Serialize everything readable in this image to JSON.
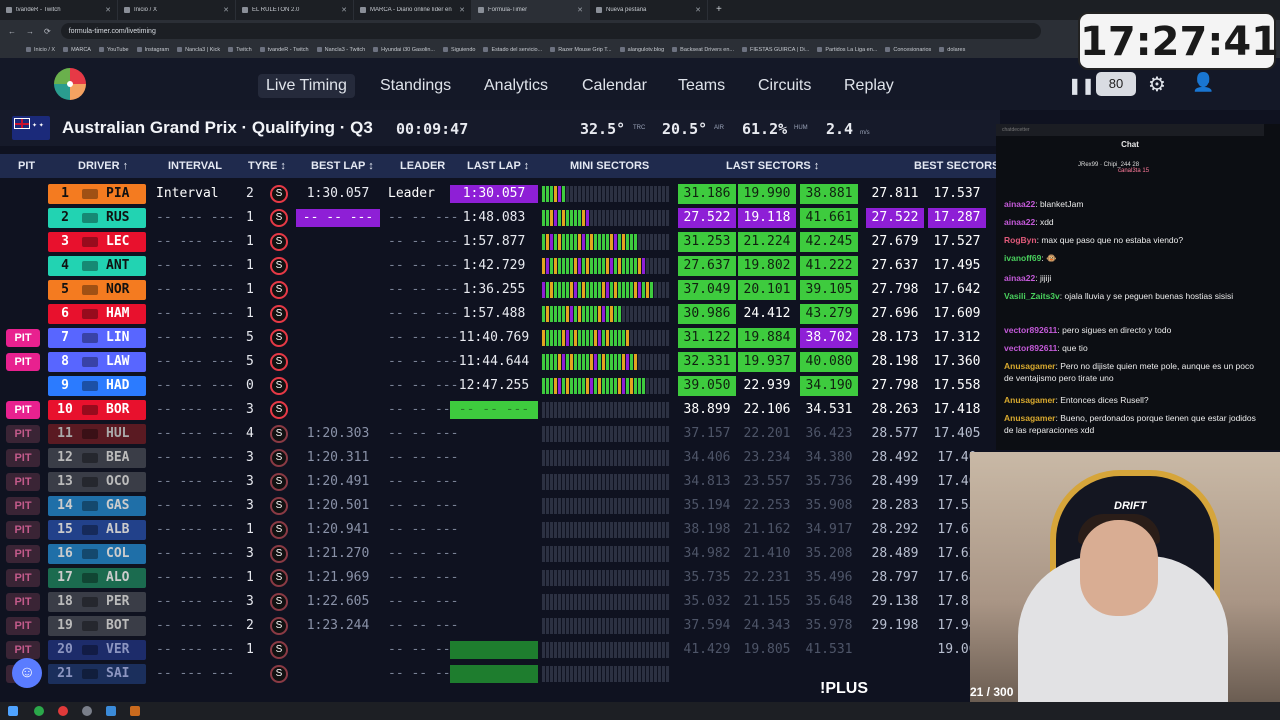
{
  "browser": {
    "tabs": [
      {
        "title": "tvandeR - Twitch",
        "active": false
      },
      {
        "title": "Inicio / X",
        "active": false
      },
      {
        "title": "EL RULETON 2.0",
        "active": false
      },
      {
        "title": "MARCA - Diario online líder en",
        "active": false
      },
      {
        "title": "Formula-Timer",
        "active": true
      },
      {
        "title": "Nueva pestaña",
        "active": false
      }
    ],
    "new_tab": "+",
    "url": "formula-timer.com/livetiming",
    "bookmarks": [
      "Inicio / X",
      "MARCA",
      "YouTube",
      "Instagram",
      "Nancla3 | Kick",
      "Twitch",
      "tvandeR - Twitch",
      "Nancla3 - Twitch",
      "Hyundai i30 Gasolin...",
      "Siguiendo",
      "Estado del servicio...",
      "Razer Mouse Grip T...",
      "alangulotv.blog",
      "Backseat Drivers en...",
      "FIESTAS GUIRCA | Di...",
      "Partidos La Liga en...",
      "Concesionarios",
      "dolares"
    ]
  },
  "nav": {
    "links": [
      "Live Timing",
      "Standings",
      "Analytics",
      "Calendar",
      "Teams",
      "Circuits",
      "Replay"
    ],
    "active": "Live Timing",
    "pause_icon": "❚❚",
    "delay_value": "80",
    "settings_icon": "⚙",
    "user_icon": "👤"
  },
  "session": {
    "title": "Australian Grand Prix · Qualifying · Q3",
    "clock": "00:09:47",
    "track_temp": "32.5°",
    "track_label": "TRC",
    "air_temp": "20.5°",
    "air_label": "AIR",
    "humidity": "61.2%",
    "humidity_label": "HUM",
    "wind": "2.4",
    "wind_unit": "m/s"
  },
  "table": {
    "headers": [
      "PIT",
      "DRIVER ↑",
      "INTERVAL",
      "TYRE ↕",
      "BEST LAP ↕",
      "LEADER",
      "LAST LAP ↕",
      "MINI SECTORS",
      "LAST SECTORS ↕",
      "BEST SECTORS"
    ],
    "rows": [
      {
        "pit": "",
        "pos": "1",
        "code": "PIA",
        "color": "#f47b20",
        "text": "#111",
        "interval": "Interval",
        "tyre_laps": "2",
        "best": "1:30.057",
        "best_bg": "",
        "leader": "Leader",
        "last": "1:30.057",
        "last_bg": "#8e1fd6",
        "ls": [
          "31.186",
          "19.990",
          "38.881"
        ],
        "ls_bg": [
          "#3ecb3e",
          "#3ecb3e",
          "#3ecb3e"
        ],
        "bs": [
          "27.811",
          "17.537",
          "3"
        ],
        "bs_bg": [
          "",
          "",
          ""
        ],
        "dim": false
      },
      {
        "pit": "",
        "pos": "2",
        "code": "RUS",
        "color": "#22d3b2",
        "text": "#111",
        "interval": "-- --- ---",
        "tyre_laps": "1",
        "best": "-- -- ---",
        "best_bg": "#8e1fd6",
        "leader": "-- -- ---",
        "last": "1:48.083",
        "last_bg": "",
        "ls": [
          "27.522",
          "19.118",
          "41.661"
        ],
        "ls_bg": [
          "#8e1fd6",
          "#8e1fd6",
          "#3ecb3e"
        ],
        "bs": [
          "27.522",
          "17.287",
          "3"
        ],
        "bs_bg": [
          "#8e1fd6",
          "#8e1fd6",
          ""
        ],
        "dim": false
      },
      {
        "pit": "",
        "pos": "3",
        "code": "LEC",
        "color": "#e8112d",
        "text": "#fff",
        "interval": "-- --- ---",
        "tyre_laps": "1",
        "best": "",
        "best_bg": "",
        "leader": "-- -- ---",
        "last": "1:57.877",
        "last_bg": "",
        "ls": [
          "31.253",
          "21.224",
          "42.245"
        ],
        "ls_bg": [
          "#3ecb3e",
          "#3ecb3e",
          "#3ecb3e"
        ],
        "bs": [
          "27.679",
          "17.527",
          "3"
        ],
        "bs_bg": [
          "",
          "",
          ""
        ],
        "dim": false
      },
      {
        "pit": "",
        "pos": "4",
        "code": "ANT",
        "color": "#22d3b2",
        "text": "#111",
        "interval": "-- --- ---",
        "tyre_laps": "1",
        "best": "",
        "best_bg": "",
        "leader": "-- -- ---",
        "last": "1:42.729",
        "last_bg": "",
        "ls": [
          "27.637",
          "19.802",
          "41.222"
        ],
        "ls_bg": [
          "#3ecb3e",
          "#3ecb3e",
          "#3ecb3e"
        ],
        "bs": [
          "27.637",
          "17.495",
          "3"
        ],
        "bs_bg": [
          "",
          "",
          ""
        ],
        "dim": false
      },
      {
        "pit": "",
        "pos": "5",
        "code": "NOR",
        "color": "#f47b20",
        "text": "#111",
        "interval": "-- --- ---",
        "tyre_laps": "1",
        "best": "",
        "best_bg": "",
        "leader": "-- -- ---",
        "last": "1:36.255",
        "last_bg": "",
        "ls": [
          "37.049",
          "20.101",
          "39.105"
        ],
        "ls_bg": [
          "#3ecb3e",
          "#3ecb3e",
          "#3ecb3e"
        ],
        "bs": [
          "27.798",
          "17.642",
          "3"
        ],
        "bs_bg": [
          "",
          "",
          ""
        ],
        "dim": false
      },
      {
        "pit": "",
        "pos": "6",
        "code": "HAM",
        "color": "#e8112d",
        "text": "#fff",
        "interval": "-- --- ---",
        "tyre_laps": "1",
        "best": "",
        "best_bg": "",
        "leader": "-- -- ---",
        "last": "1:57.488",
        "last_bg": "",
        "ls": [
          "30.986",
          "24.412",
          "43.279"
        ],
        "ls_bg": [
          "#3ecb3e",
          "",
          "#3ecb3e"
        ],
        "bs": [
          "27.696",
          "17.609",
          "3"
        ],
        "bs_bg": [
          "",
          "",
          ""
        ],
        "dim": false
      },
      {
        "pit": "PIT",
        "pos": "7",
        "code": "LIN",
        "color": "#5866ff",
        "text": "#fff",
        "interval": "-- --- ---",
        "tyre_laps": "5",
        "best": "",
        "best_bg": "",
        "leader": "-- -- ---",
        "last": "11:40.769",
        "last_bg": "",
        "ls": [
          "31.122",
          "19.884",
          "38.702"
        ],
        "ls_bg": [
          "#3ecb3e",
          "#3ecb3e",
          "#8e1fd6"
        ],
        "bs": [
          "28.173",
          "17.312",
          "3"
        ],
        "bs_bg": [
          "",
          "",
          ""
        ],
        "dim": false
      },
      {
        "pit": "PIT",
        "pos": "8",
        "code": "LAW",
        "color": "#5866ff",
        "text": "#fff",
        "interval": "-- --- ---",
        "tyre_laps": "5",
        "best": "",
        "best_bg": "",
        "leader": "-- -- ---",
        "last": "11:44.644",
        "last_bg": "",
        "ls": [
          "32.331",
          "19.937",
          "40.080"
        ],
        "ls_bg": [
          "#3ecb3e",
          "#3ecb3e",
          "#3ecb3e"
        ],
        "bs": [
          "28.198",
          "17.360",
          "3"
        ],
        "bs_bg": [
          "",
          "",
          ""
        ],
        "dim": false
      },
      {
        "pit": "",
        "pos": "9",
        "code": "HAD",
        "color": "#2b7bff",
        "text": "#fff",
        "interval": "-- --- ---",
        "tyre_laps": "0",
        "best": "",
        "best_bg": "",
        "leader": "-- -- ---",
        "last": "12:47.255",
        "last_bg": "",
        "ls": [
          "39.050",
          "22.939",
          "34.190"
        ],
        "ls_bg": [
          "#3ecb3e",
          "",
          "#3ecb3e"
        ],
        "bs": [
          "27.798",
          "17.558",
          "3"
        ],
        "bs_bg": [
          "",
          "",
          ""
        ],
        "dim": false
      },
      {
        "pit": "PIT",
        "pos": "10",
        "code": "BOR",
        "color": "#e8112d",
        "text": "#fff",
        "interval": "-- --- ---",
        "tyre_laps": "3",
        "best": "",
        "best_bg": "",
        "leader": "-- -- ---",
        "last": "-- -- ---",
        "last_bg": "#3ecb3e",
        "ls": [
          "38.899",
          "22.106",
          "34.531"
        ],
        "ls_bg": [
          "",
          "",
          ""
        ],
        "bs": [
          "28.263",
          "17.418",
          "3"
        ],
        "bs_bg": [
          "",
          "",
          ""
        ],
        "dim": false
      },
      {
        "pit": "PIT",
        "pos": "11",
        "code": "HUL",
        "color": "#5a1a22",
        "text": "#aaa",
        "interval": "-- --- ---",
        "tyre_laps": "4",
        "best": "1:20.303",
        "best_bg": "",
        "leader": "-- -- ---",
        "last": "",
        "last_bg": "",
        "ls": [
          "37.157",
          "22.201",
          "36.423"
        ],
        "ls_bg": [
          "",
          "",
          ""
        ],
        "bs": [
          "28.577",
          "17.405",
          "3"
        ],
        "bs_bg": [
          "",
          "",
          ""
        ],
        "dim": true
      },
      {
        "pit": "PIT",
        "pos": "12",
        "code": "BEA",
        "color": "#3a3d47",
        "text": "#bbb",
        "interval": "-- --- ---",
        "tyre_laps": "3",
        "best": "1:20.311",
        "best_bg": "",
        "leader": "-- -- ---",
        "last": "",
        "last_bg": "",
        "ls": [
          "34.406",
          "23.234",
          "34.380"
        ],
        "ls_bg": [
          "",
          "",
          ""
        ],
        "bs": [
          "28.492",
          "17.40",
          ""
        ],
        "bs_bg": [
          "",
          "",
          ""
        ],
        "dim": true
      },
      {
        "pit": "PIT",
        "pos": "13",
        "code": "OCO",
        "color": "#3a3d47",
        "text": "#bbb",
        "interval": "-- --- ---",
        "tyre_laps": "3",
        "best": "1:20.491",
        "best_bg": "",
        "leader": "-- -- ---",
        "last": "",
        "last_bg": "",
        "ls": [
          "34.813",
          "23.557",
          "35.736"
        ],
        "ls_bg": [
          "",
          "",
          ""
        ],
        "bs": [
          "28.499",
          "17.46",
          ""
        ],
        "bs_bg": [
          "",
          "",
          ""
        ],
        "dim": true
      },
      {
        "pit": "PIT",
        "pos": "14",
        "code": "GAS",
        "color": "#1f6fa8",
        "text": "#ccc",
        "interval": "-- --- ---",
        "tyre_laps": "3",
        "best": "1:20.501",
        "best_bg": "",
        "leader": "-- -- ---",
        "last": "",
        "last_bg": "",
        "ls": [
          "35.194",
          "22.253",
          "35.908"
        ],
        "ls_bg": [
          "",
          "",
          ""
        ],
        "bs": [
          "28.283",
          "17.55",
          ""
        ],
        "bs_bg": [
          "",
          "",
          ""
        ],
        "dim": true
      },
      {
        "pit": "PIT",
        "pos": "15",
        "code": "ALB",
        "color": "#22418a",
        "text": "#ccc",
        "interval": "-- --- ---",
        "tyre_laps": "1",
        "best": "1:20.941",
        "best_bg": "",
        "leader": "-- -- ---",
        "last": "",
        "last_bg": "",
        "ls": [
          "38.198",
          "21.162",
          "34.917"
        ],
        "ls_bg": [
          "",
          "",
          ""
        ],
        "bs": [
          "28.292",
          "17.67",
          ""
        ],
        "bs_bg": [
          "",
          "",
          ""
        ],
        "dim": true
      },
      {
        "pit": "PIT",
        "pos": "16",
        "code": "COL",
        "color": "#1f6fa8",
        "text": "#ccc",
        "interval": "-- --- ---",
        "tyre_laps": "3",
        "best": "1:21.270",
        "best_bg": "",
        "leader": "-- -- ---",
        "last": "",
        "last_bg": "",
        "ls": [
          "34.982",
          "21.410",
          "35.208"
        ],
        "ls_bg": [
          "",
          "",
          ""
        ],
        "bs": [
          "28.489",
          "17.62",
          ""
        ],
        "bs_bg": [
          "",
          "",
          ""
        ],
        "dim": true
      },
      {
        "pit": "PIT",
        "pos": "17",
        "code": "ALO",
        "color": "#1b6b4f",
        "text": "#ccc",
        "interval": "-- --- ---",
        "tyre_laps": "1",
        "best": "1:21.969",
        "best_bg": "",
        "leader": "-- -- ---",
        "last": "",
        "last_bg": "",
        "ls": [
          "35.735",
          "22.231",
          "35.496"
        ],
        "ls_bg": [
          "",
          "",
          ""
        ],
        "bs": [
          "28.797",
          "17.68",
          ""
        ],
        "bs_bg": [
          "",
          "",
          ""
        ],
        "dim": true
      },
      {
        "pit": "PIT",
        "pos": "18",
        "code": "PER",
        "color": "#3a3d47",
        "text": "#bbb",
        "interval": "-- --- ---",
        "tyre_laps": "3",
        "best": "1:22.605",
        "best_bg": "",
        "leader": "-- -- ---",
        "last": "",
        "last_bg": "",
        "ls": [
          "35.032",
          "21.155",
          "35.648"
        ],
        "ls_bg": [
          "",
          "",
          ""
        ],
        "bs": [
          "29.138",
          "17.81",
          ""
        ],
        "bs_bg": [
          "",
          "",
          ""
        ],
        "dim": true
      },
      {
        "pit": "PIT",
        "pos": "19",
        "code": "BOT",
        "color": "#3a3d47",
        "text": "#bbb",
        "interval": "-- --- ---",
        "tyre_laps": "2",
        "best": "1:23.244",
        "best_bg": "",
        "leader": "-- -- ---",
        "last": "",
        "last_bg": "",
        "ls": [
          "37.594",
          "24.343",
          "35.978"
        ],
        "ls_bg": [
          "",
          "",
          ""
        ],
        "bs": [
          "29.198",
          "17.94",
          ""
        ],
        "bs_bg": [
          "",
          "",
          ""
        ],
        "dim": true
      },
      {
        "pit": "PIT",
        "pos": "20",
        "code": "VER",
        "color": "#1d2c6a",
        "text": "#8c95c0",
        "interval": "-- --- ---",
        "tyre_laps": "1",
        "best": "",
        "best_bg": "",
        "leader": "-- -- ---",
        "last": "",
        "last_bg": "#1e7d2e",
        "ls": [
          "41.429",
          "19.805",
          "41.531"
        ],
        "ls_bg": [
          "",
          "",
          ""
        ],
        "bs": [
          "",
          "19.06",
          ""
        ],
        "bs_bg": [
          "",
          "",
          ""
        ],
        "dim": true
      },
      {
        "pit": "PIT",
        "pos": "21",
        "code": "SAI",
        "color": "#1b2f5c",
        "text": "#8c95c0",
        "interval": "-- --- ---",
        "tyre_laps": "",
        "best": "",
        "best_bg": "",
        "leader": "-- -- ---",
        "last": "",
        "last_bg": "#1e7d2e",
        "ls": [
          "",
          "",
          ""
        ],
        "ls_bg": [
          "",
          "",
          ""
        ],
        "bs": [
          "",
          "",
          ""
        ],
        "bs_bg": [
          "",
          "",
          ""
        ],
        "dim": true
      }
    ]
  },
  "chat": {
    "header_hint": "chatdecetter",
    "title": "Chat",
    "leaders": [
      "JRex99 · Chipi_244 28",
      "canal3ta 15"
    ],
    "messages": [
      {
        "user": "ainaa22",
        "text": "blanketJam",
        "color": "#c45ad9"
      },
      {
        "user": "ainaa22",
        "text": "xdd",
        "color": "#c45ad9"
      },
      {
        "user": "RogByn",
        "text": "max que paso que no estaba viendo?",
        "color": "#e05a7a"
      },
      {
        "user": "ivanoff69",
        "text": "🐵",
        "color": "#49d15d"
      },
      {
        "user": "ainaa22",
        "text": "jijiji",
        "color": "#c45ad9"
      },
      {
        "user": "Vasili_Zaits3v",
        "text": "ojala lluvia y se peguen buenas hostias sisisi",
        "color": "#49d15d"
      },
      {
        "user": "vector892611",
        "text": "pero sigues en directo y todo",
        "color": "#c45ad9"
      },
      {
        "user": "vector892611",
        "text": "que tio",
        "color": "#c45ad9"
      },
      {
        "user": "Anusagamer",
        "text": "Pero no dijiste quien mete pole, aunque es un poco de ventajismo pero tirate uno",
        "color": "#d8a92e"
      },
      {
        "user": "Anusagamer",
        "text": "Entonces dices Rusell?",
        "color": "#d8a92e"
      },
      {
        "user": "Anusagamer",
        "text": "Bueno, perdonados porque tienen que estar jodidos de las reparaciones xdd",
        "color": "#d8a92e"
      }
    ]
  },
  "overlay": {
    "clock": "17:27:41",
    "chair_brand": "DRIFT",
    "plus_label": "!PLUS",
    "viewer_count": "21 / 300"
  }
}
